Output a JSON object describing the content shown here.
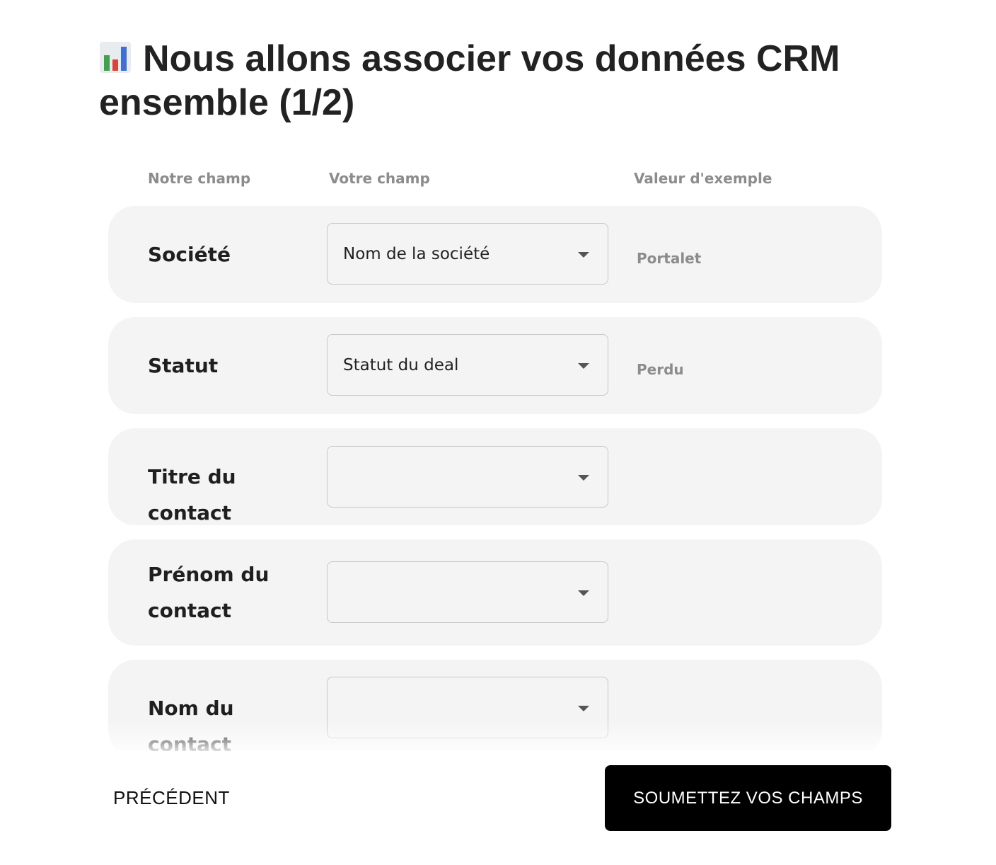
{
  "page": {
    "title": "Nous allons associer vos données CRM ensemble (1/2)",
    "title_icon": "bar-chart-emoji-icon"
  },
  "table_headers": {
    "our_field": "Notre champ",
    "your_field": "Votre champ",
    "example_value": "Valeur d'exemple"
  },
  "rows": [
    {
      "label": "Société",
      "selected": "Nom de la société",
      "example": "Portalet"
    },
    {
      "label": "Statut",
      "selected": "Statut du deal",
      "example": "Perdu"
    },
    {
      "label": "Titre du contact",
      "selected": "",
      "example": ""
    },
    {
      "label": "Prénom du contact",
      "selected": "",
      "example": ""
    },
    {
      "label": "Nom du contact",
      "selected": "",
      "example": ""
    }
  ],
  "actions": {
    "previous_label": "PRÉCÉDENT",
    "submit_label": "SOUMETTEZ VOS CHAMPS"
  },
  "colors": {
    "row_background": "#f3f4f3",
    "submit_background": "#000000",
    "muted_text": "#8c8c8c"
  }
}
